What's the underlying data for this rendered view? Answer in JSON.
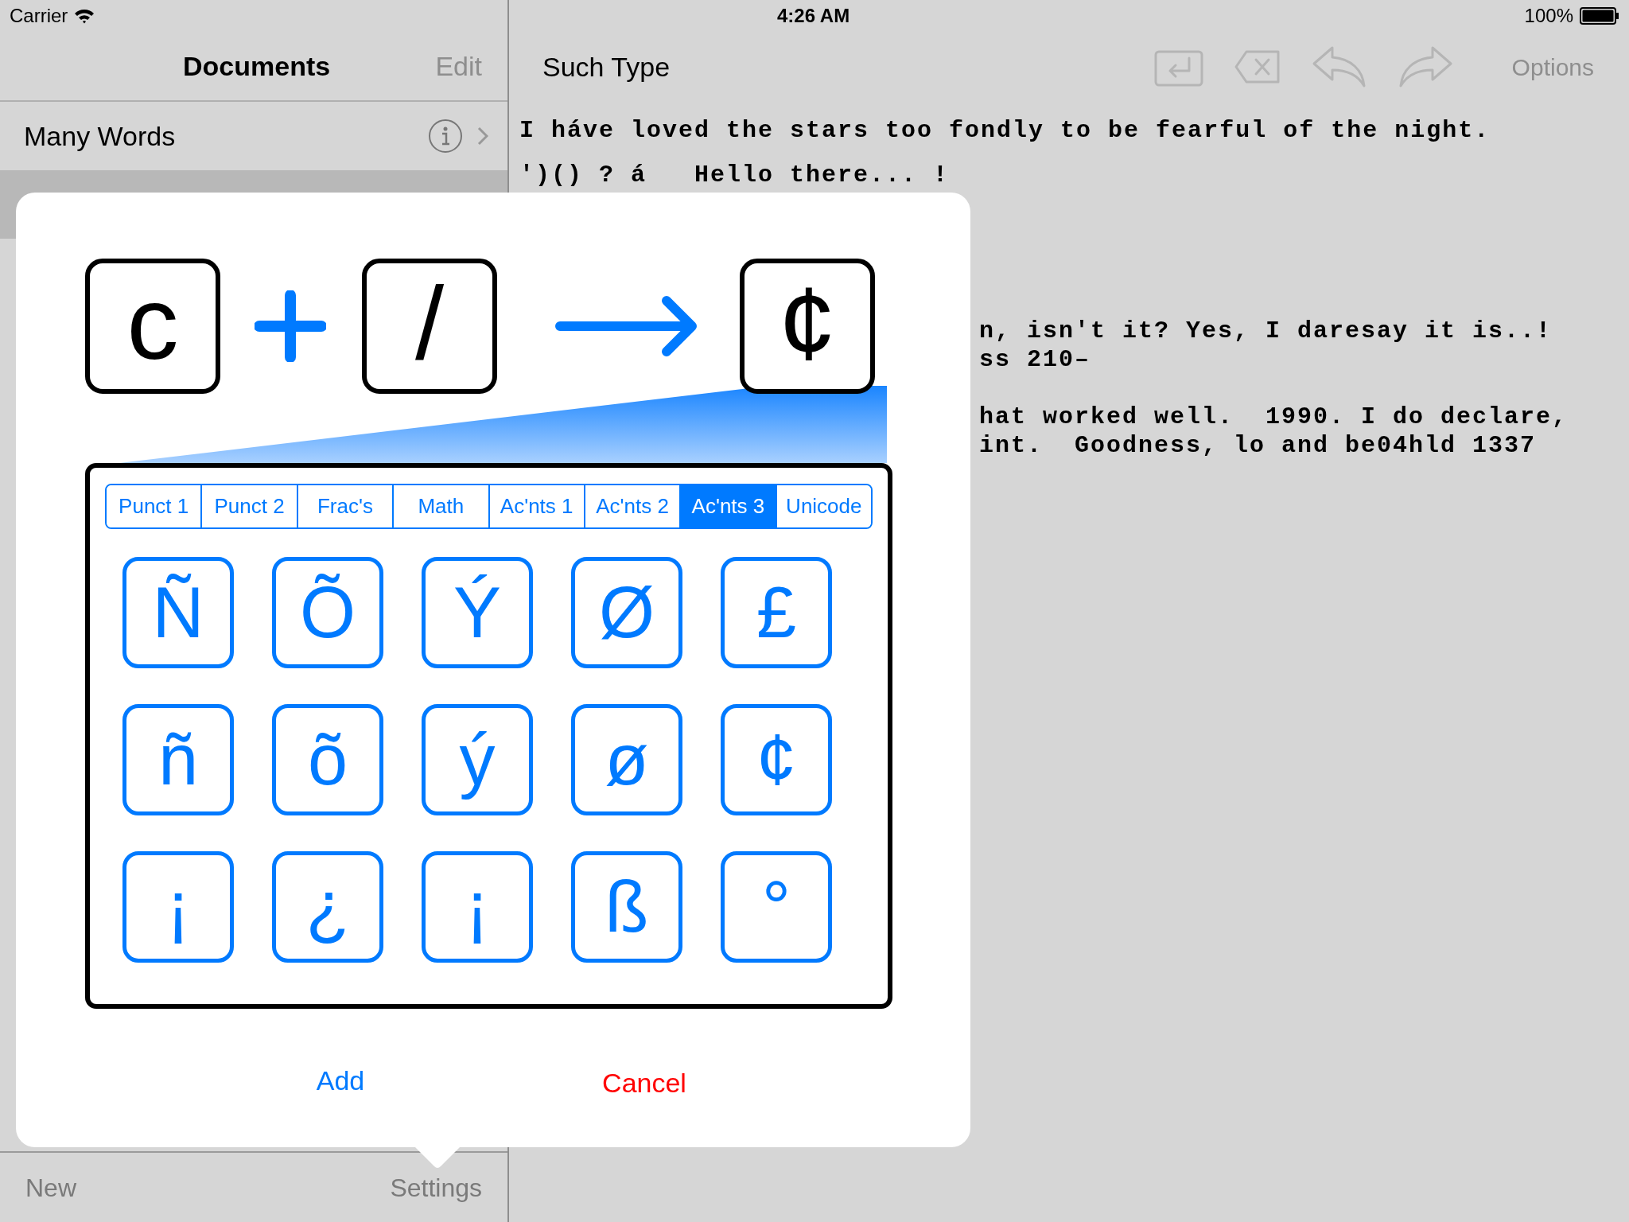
{
  "status_bar": {
    "carrier": "Carrier",
    "time": "4:26 AM",
    "battery": "100%"
  },
  "sidebar": {
    "title": "Documents",
    "edit": "Edit",
    "items": [
      {
        "label": "Many Words",
        "selected": false
      }
    ],
    "toolbar": {
      "new": "New",
      "settings": "Settings"
    }
  },
  "editor": {
    "title": "Such Type",
    "tools": [
      {
        "kind": "return",
        "disabled": true
      },
      {
        "kind": "delete",
        "disabled": true
      },
      {
        "kind": "undo",
        "disabled": true
      },
      {
        "kind": "redo",
        "disabled": true
      }
    ],
    "options": "Options",
    "paragraphs": [
      {
        "clipped": false,
        "lines": [
          "I háve loved the stars too fondly to be fearful of the night."
        ]
      },
      {
        "clipped": false,
        "lines": [
          "')() ? á   Hello there... !"
        ]
      },
      {
        "clipped": true,
        "lines": [
          "n, isn't it? Yes, I daresay it is..!",
          "ss 210–"
        ]
      },
      {
        "clipped": true,
        "lines": [
          "hat worked well.  1990. I do declare,",
          "int.  Goodness, lo and be04hld 1337"
        ]
      }
    ]
  },
  "popover": {
    "combo": {
      "keys": [
        "c",
        "/"
      ],
      "result": "¢"
    },
    "tabs": [
      {
        "label": "Punct 1",
        "selected": false
      },
      {
        "label": "Punct 2",
        "selected": false
      },
      {
        "label": "Frac's",
        "selected": false
      },
      {
        "label": "Math",
        "selected": false
      },
      {
        "label": "Ac'nts 1",
        "selected": false
      },
      {
        "label": "Ac'nts 2",
        "selected": false
      },
      {
        "label": "Ac'nts 3",
        "selected": true
      },
      {
        "label": "Unicode",
        "selected": false
      }
    ],
    "keys": [
      "Ñ",
      "Õ",
      "Ý",
      "Ø",
      "£",
      "ñ",
      "õ",
      "ý",
      "ø",
      "¢",
      "¡",
      "¿",
      "¡",
      "ß",
      "°"
    ],
    "add": "Add",
    "cancel": "Cancel"
  }
}
